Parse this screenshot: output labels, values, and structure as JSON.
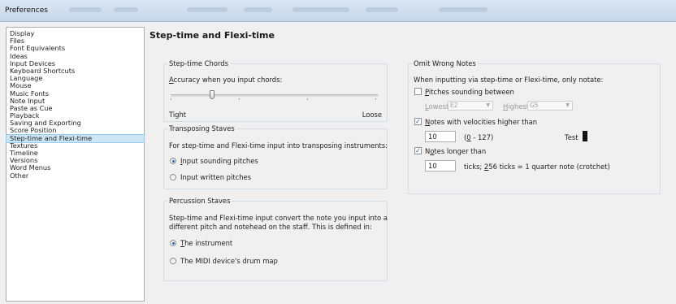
{
  "window": {
    "title": "Preferences"
  },
  "sidebar": {
    "items": [
      {
        "label": "Display"
      },
      {
        "label": "Files"
      },
      {
        "label": "Font Equivalents"
      },
      {
        "label": "Ideas"
      },
      {
        "label": "Input Devices"
      },
      {
        "label": "Keyboard Shortcuts"
      },
      {
        "label": "Language"
      },
      {
        "label": "Mouse"
      },
      {
        "label": "Music Fonts"
      },
      {
        "label": "Note Input"
      },
      {
        "label": "Paste as Cue"
      },
      {
        "label": "Playback"
      },
      {
        "label": "Saving and Exporting"
      },
      {
        "label": "Score Position"
      },
      {
        "label": "Step-time and Flexi-time",
        "selected": true
      },
      {
        "label": "Textures"
      },
      {
        "label": "Timeline"
      },
      {
        "label": "Versions"
      },
      {
        "label": "Word Menus"
      },
      {
        "label": "Other"
      }
    ]
  },
  "page": {
    "title": "Step-time and Flexi-time"
  },
  "chords": {
    "title": "Step-time Chords",
    "accuracy_prefix": "A",
    "accuracy_rest": "ccuracy when you input chords:",
    "slider_value": 0.2,
    "tight": "Tight",
    "loose": "Loose"
  },
  "transposing": {
    "title": "Transposing Staves",
    "description": "For step-time and Flexi-time input into transposing instruments:",
    "opt1_prefix": "I",
    "opt1_rest": "nput sounding pitches",
    "opt1_selected": true,
    "opt2": "Input written pitches"
  },
  "percussion": {
    "title": "Percussion Staves",
    "desc_line1": "Step-time and Flexi-time input convert the note you input into a",
    "desc_line2": "different pitch and notehead on the staff. This is defined in:",
    "opt1_prefix": "T",
    "opt1_rest": "he instrument",
    "opt1_selected": true,
    "opt2": "The MIDI device's drum map"
  },
  "omit": {
    "title": "Omit Wrong Notes",
    "description": "When inputting via step-time or Flexi-time, only notate:",
    "pitches": {
      "prefix": "P",
      "rest": "itches sounding between",
      "checked": false
    },
    "lowest_prefix": "L",
    "lowest_rest": "owest",
    "lowest_value": "E2",
    "highest_prefix": "H",
    "highest_rest": "ighest",
    "highest_value": "G5",
    "velocities": {
      "prefix": "N",
      "rest": "otes with velocities higher than",
      "checked": true
    },
    "velocity_value": "10",
    "velocity_range_prefix": "(",
    "velocity_range_u": "0",
    "velocity_range_rest": " - 127)",
    "test_label": "Test",
    "longer": {
      "pre": "N",
      "u": "o",
      "post": "tes longer than",
      "checked": true
    },
    "ticks_value": "10",
    "ticks_label_pre": "ticks; ",
    "ticks_label_u": "2",
    "ticks_label_post": "56 ticks = 1 quarter note (crotchet)"
  }
}
